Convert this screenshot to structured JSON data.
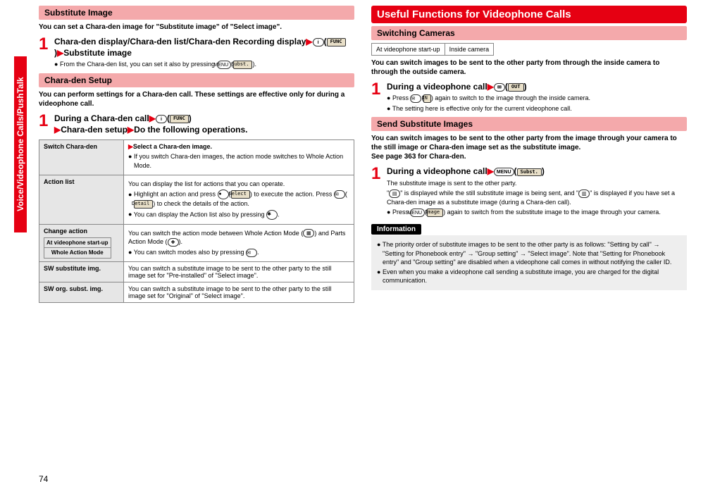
{
  "side_tab": "Voice/Videophone Calls/PushTalk",
  "page_number": "74",
  "labels": {
    "func": "FUNC",
    "subst": "Subst.",
    "select": "Select",
    "detail": "Detail",
    "out": "OUT",
    "in": "IN",
    "image": "Image"
  },
  "left": {
    "h1": "Substitute Image",
    "intro": "You can set a Chara-den image for \"Substitute image\" of \"Select image\".",
    "step1_title_a": "Chara-den display/Chara-den list/Chara-den Recording display",
    "step1_title_b": "Substitute image",
    "step1_bullet": "From the Chara-den list, you can set it also by pressing ",
    "h2": "Chara-den Setup",
    "intro2": "You can perform settings for a Chara-den call. These settings are effective only for during a videophone call.",
    "step2_title_a": "During a Chara-den call",
    "step2_title_b": "Chara-den setup",
    "step2_title_c": "Do the following operations.",
    "table": {
      "r1_label": "Switch Chara-den",
      "r1_select": "Select a Chara-den image.",
      "r1_b1": "If you switch Chara-den images, the action mode switches to Whole Action Mode.",
      "r2_label": "Action list",
      "r2_t1": "You can display the list for actions that you can operate.",
      "r2_b1a": "Highlight an action and press ",
      "r2_b1b": " to execute the action. Press ",
      "r2_b1c": " to check the details of the action.",
      "r2_b2": "You can display the Action list also by pressing ",
      "r3_label": "Change action",
      "r3_box_a": "At videophone start-up",
      "r3_box_b": "Whole Action Mode",
      "r3_t1": "You can switch the action mode between Whole Action Mode (",
      "r3_t1b": ") and Parts Action Mode (",
      "r3_t1c": ").",
      "r3_b1": "You can switch modes also by pressing ",
      "r4_label": "SW substitute img.",
      "r4_t1": "You can switch a substitute image to be sent to the other party to the still image set for \"Pre-installed\" of \"Select image\".",
      "r5_label": "SW org. subst. img.",
      "r5_t1": "You can switch a substitute image to be sent to the other party to the still image set for \"Original\" of \"Select image\"."
    }
  },
  "right": {
    "h1": "Useful Functions for Videophone Calls",
    "h2": "Switching Cameras",
    "tbl_a": "At videophone start-up",
    "tbl_b": "Inside camera",
    "intro": "You can switch images to be sent to the other party from through the inside camera to through the outside camera.",
    "step1_title": "During a videophone call",
    "step1_b1a": "Press ",
    "step1_b1b": " again to switch to the image through the inside camera.",
    "step1_b2": "The setting here is effective only for the current videophone call.",
    "h3": "Send Substitute Images",
    "intro2a": "You can switch images to be sent to the other party from the image through your camera to the still image or Chara-den image set as the substitute image.",
    "intro2b": "See page 363 for Chara-den.",
    "step2_title": "During a videophone call",
    "step2_line1": "The substitute image is sent to the other party.",
    "step2_line2a": "\"",
    "step2_line2b": "\" is displayed while the still substitute image is being sent, and \"",
    "step2_line2c": "\" is displayed if you have set a Chara-den image as a substitute image (during a Chara-den call).",
    "step2_b1a": "Press ",
    "step2_b1b": " again to switch from the substitute image to the image through your camera.",
    "info_title": "Information",
    "info_b1": "The priority order of substitute images to be sent to the other party is as follows: \"Setting by call\" → \"Setting for Phonebook entry\" → \"Group setting\" → \"Select image\". Note that \"Setting for Phonebook entry\" and \"Group setting\" are disabled when a videophone call comes in without notifying the caller ID.",
    "info_b2": "Even when you make a videophone call sending a substitute image, you are charged for the digital communication."
  }
}
